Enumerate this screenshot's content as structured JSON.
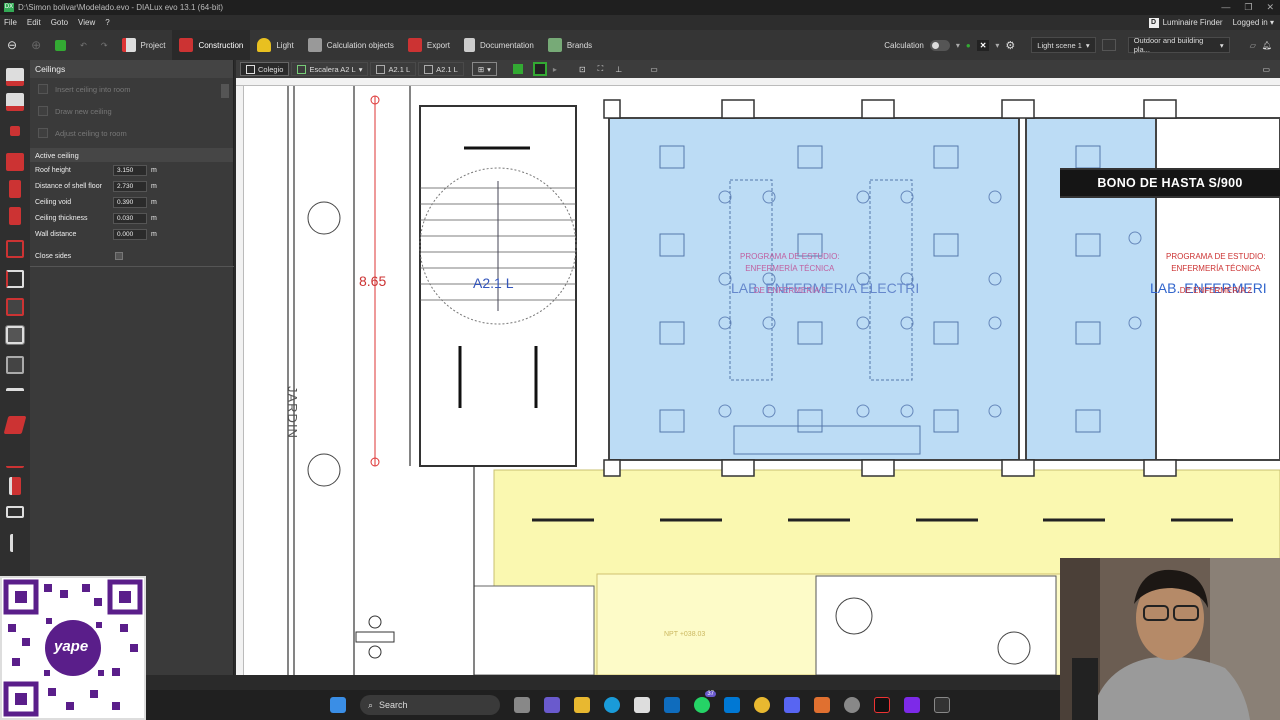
{
  "window": {
    "title": "D:\\Simon bolivar\\Modelado.evo - DIALux evo 13.1  (64-bit)"
  },
  "menu": {
    "items": [
      "File",
      "Edit",
      "Goto",
      "View",
      "?"
    ],
    "luminaire_finder": "Luminaire Finder",
    "logged_in": "Logged in"
  },
  "toolbar": {
    "items": [
      {
        "label": "Project",
        "color": "#d33"
      },
      {
        "label": "Construction",
        "color": "#c33"
      },
      {
        "label": "Light",
        "color": "#e8c020"
      },
      {
        "label": "Calculation objects",
        "color": "#999"
      },
      {
        "label": "Export",
        "color": "#c33"
      },
      {
        "label": "Documentation",
        "color": "#aaa"
      },
      {
        "label": "Brands",
        "color": "#7a7"
      }
    ],
    "calculation": "Calculation",
    "light_scene": "Light scene 1",
    "view_mode": "Outdoor and building pla..."
  },
  "panel": {
    "title": "Ceilings",
    "tools": [
      "Insert ceiling into room",
      "Draw new ceiling",
      "Adjust ceiling to room"
    ],
    "section": "Active ceiling",
    "props": [
      {
        "label": "Roof height",
        "value": "3.150",
        "unit": "m"
      },
      {
        "label": "Distance of shell floor",
        "value": "2.730",
        "unit": "m"
      },
      {
        "label": "Ceiling void",
        "value": "0.390",
        "unit": "m"
      },
      {
        "label": "Ceiling thickness",
        "value": "0.030",
        "unit": "m"
      },
      {
        "label": "Wall distance",
        "value": "0.000",
        "unit": "m"
      }
    ],
    "close_sides": "Close sides"
  },
  "view_tabs": [
    "Colegio",
    "Escalera A2 L",
    "A2.1 L",
    "A2.1 L"
  ],
  "plan": {
    "dimension": "8.65",
    "stair_label": "A2.1 L",
    "garden_label": "JARDIN",
    "room_label_1": "LAB. ENFERMERIA ELECTRI",
    "room_label_2": "LAB. ENFERMERI",
    "program_1": [
      "PROGRAMA DE ESTUDIO:",
      "ENFERMERÍA TÉCNICA",
      "DE ENFERMERÍA 3"
    ],
    "program_2": [
      "PROGRAMA DE ESTUDIO:",
      "ENFERMERÍA TÉCNICA",
      "DE ENFERMERÍA 2"
    ],
    "npt": "NPT +038.03"
  },
  "overlay": {
    "banner": "BONO DE HASTA S/900",
    "qr_brand": "yape"
  },
  "taskbar": {
    "search": "Search",
    "badge": "37"
  }
}
